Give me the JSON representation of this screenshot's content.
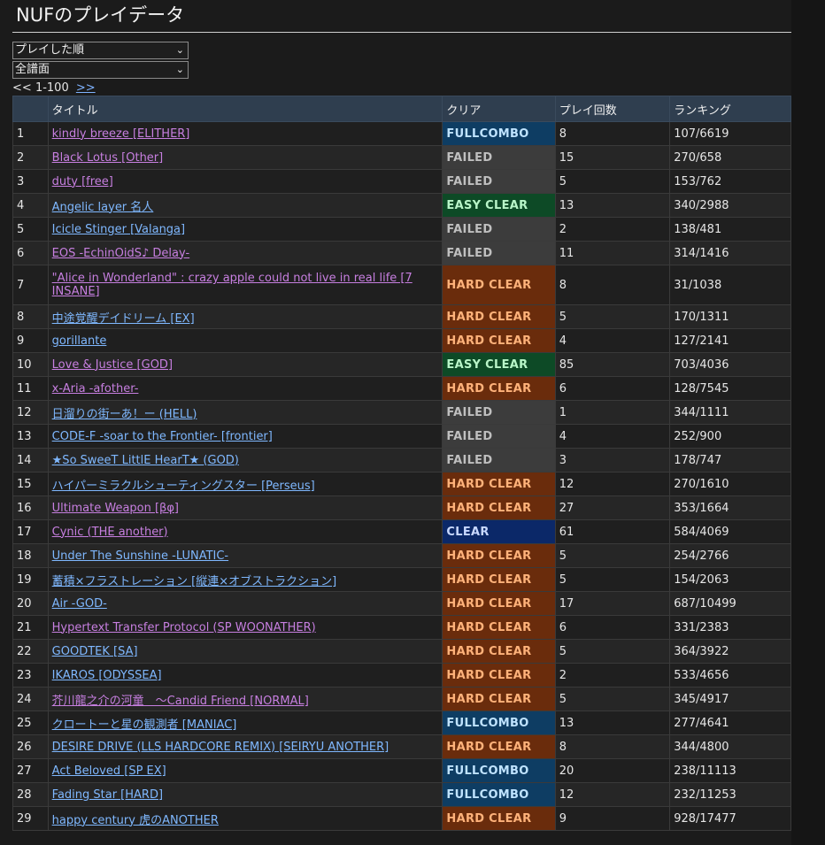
{
  "page": {
    "title": "NUFのプレイデータ",
    "sort_select": "プレイした順",
    "filter_select": "全譜面",
    "pager_prev": "<<",
    "pager_range": "1-100",
    "pager_next": ">>"
  },
  "table": {
    "headers": {
      "no": "",
      "title": "タイトル",
      "clear": "クリア",
      "plays": "プレイ回数",
      "rank": "ランキング"
    },
    "rows": [
      {
        "no": "1",
        "title": "kindly breeze [ELITHER]",
        "link": "purple",
        "clear": "FULLCOMBO",
        "status": "FULLCOMBO",
        "plays": "8",
        "rank": "107/6619"
      },
      {
        "no": "2",
        "title": "Black Lotus [Other]",
        "link": "purple",
        "clear": "FAILED",
        "status": "FAILED",
        "plays": "15",
        "rank": "270/658"
      },
      {
        "no": "3",
        "title": "duty [free]",
        "link": "purple",
        "clear": "FAILED",
        "status": "FAILED",
        "plays": "5",
        "rank": "153/762"
      },
      {
        "no": "4",
        "title": "Angelic layer 名人",
        "link": "blue",
        "clear": "EASY CLEAR",
        "status": "EASY",
        "plays": "13",
        "rank": "340/2988"
      },
      {
        "no": "5",
        "title": "Icicle Stinger [Valanga]",
        "link": "blue",
        "clear": "FAILED",
        "status": "FAILED",
        "plays": "2",
        "rank": "138/481"
      },
      {
        "no": "6",
        "title": "EOS -EchinOidS♪ Delay-",
        "link": "purple",
        "clear": "FAILED",
        "status": "FAILED",
        "plays": "11",
        "rank": "314/1416"
      },
      {
        "no": "7",
        "title": "\"Alice in Wonderland\" : crazy apple could not live in real life [7 INSANE]",
        "link": "purple",
        "clear": "HARD CLEAR",
        "status": "HARD",
        "plays": "8",
        "rank": "31/1038",
        "tall": true
      },
      {
        "no": "8",
        "title": "中途覚醒デイドリーム [EX]",
        "link": "blue",
        "clear": "HARD CLEAR",
        "status": "HARD",
        "plays": "5",
        "rank": "170/1311"
      },
      {
        "no": "9",
        "title": "gorillante",
        "link": "blue",
        "clear": "HARD CLEAR",
        "status": "HARD",
        "plays": "4",
        "rank": "127/2141"
      },
      {
        "no": "10",
        "title": "Love & Justice [GOD]",
        "link": "purple",
        "clear": "EASY CLEAR",
        "status": "EASY",
        "plays": "85",
        "rank": "703/4036"
      },
      {
        "no": "11",
        "title": "x-Aria -afother-",
        "link": "purple",
        "clear": "HARD CLEAR",
        "status": "HARD",
        "plays": "6",
        "rank": "128/7545"
      },
      {
        "no": "12",
        "title": "日溜りの街ーあ！ー (HELL)",
        "link": "blue",
        "clear": "FAILED",
        "status": "FAILED",
        "plays": "1",
        "rank": "344/1111"
      },
      {
        "no": "13",
        "title": "CODE-F -soar to the Frontier- [frontier]",
        "link": "blue",
        "clear": "FAILED",
        "status": "FAILED",
        "plays": "4",
        "rank": "252/900"
      },
      {
        "no": "14",
        "title": "★So SweeT LittlE HearT★ (GOD)",
        "link": "blue",
        "clear": "FAILED",
        "status": "FAILED",
        "plays": "3",
        "rank": "178/747"
      },
      {
        "no": "15",
        "title": "ハイパーミラクルシューティングスター [Perseus]",
        "link": "blue",
        "clear": "HARD CLEAR",
        "status": "HARD",
        "plays": "12",
        "rank": "270/1610"
      },
      {
        "no": "16",
        "title": "Ultimate Weapon [βφ]",
        "link": "purple",
        "clear": "HARD CLEAR",
        "status": "HARD",
        "plays": "27",
        "rank": "353/1664"
      },
      {
        "no": "17",
        "title": "Cynic (THE another)",
        "link": "purple",
        "clear": "CLEAR",
        "status": "CLEAR",
        "plays": "61",
        "rank": "584/4069"
      },
      {
        "no": "18",
        "title": "Under The Sunshine -LUNATIC-",
        "link": "blue",
        "clear": "HARD CLEAR",
        "status": "HARD",
        "plays": "5",
        "rank": "254/2766"
      },
      {
        "no": "19",
        "title": "蓄積×フラストレーション [縦連×オブストラクション]",
        "link": "blue",
        "clear": "HARD CLEAR",
        "status": "HARD",
        "plays": "5",
        "rank": "154/2063"
      },
      {
        "no": "20",
        "title": "Air -GOD-",
        "link": "blue",
        "clear": "HARD CLEAR",
        "status": "HARD",
        "plays": "17",
        "rank": "687/10499"
      },
      {
        "no": "21",
        "title": "Hypertext Transfer Protocol (SP WOONATHER)",
        "link": "purple",
        "clear": "HARD CLEAR",
        "status": "HARD",
        "plays": "6",
        "rank": "331/2383"
      },
      {
        "no": "22",
        "title": "GOODTEK [SA]",
        "link": "blue",
        "clear": "HARD CLEAR",
        "status": "HARD",
        "plays": "5",
        "rank": "364/3922"
      },
      {
        "no": "23",
        "title": "IKAROS [ODYSSEA]",
        "link": "blue",
        "clear": "HARD CLEAR",
        "status": "HARD",
        "plays": "2",
        "rank": "533/4656"
      },
      {
        "no": "24",
        "title": "芥川龍之介の河童　～Candid Friend [NORMAL]",
        "link": "purple",
        "clear": "HARD CLEAR",
        "status": "HARD",
        "plays": "5",
        "rank": "345/4917"
      },
      {
        "no": "25",
        "title": "クロートーと星の観測者 [MANIAC]",
        "link": "blue",
        "clear": "FULLCOMBO",
        "status": "FULLCOMBO",
        "plays": "13",
        "rank": "277/4641"
      },
      {
        "no": "26",
        "title": "DESIRE DRIVE (LLS HARDCORE REMIX) [SEIRYU ANOTHER]",
        "link": "blue",
        "clear": "HARD CLEAR",
        "status": "HARD",
        "plays": "8",
        "rank": "344/4800"
      },
      {
        "no": "27",
        "title": "Act Beloved [SP EX]",
        "link": "blue",
        "clear": "FULLCOMBO",
        "status": "FULLCOMBO",
        "plays": "20",
        "rank": "238/11113"
      },
      {
        "no": "28",
        "title": "Fading Star [HARD]",
        "link": "blue",
        "clear": "FULLCOMBO",
        "status": "FULLCOMBO",
        "plays": "12",
        "rank": "232/11253"
      },
      {
        "no": "29",
        "title": "happy century 虎のANOTHER",
        "link": "blue",
        "clear": "HARD CLEAR",
        "status": "HARD",
        "plays": "9",
        "rank": "928/17477"
      }
    ]
  }
}
